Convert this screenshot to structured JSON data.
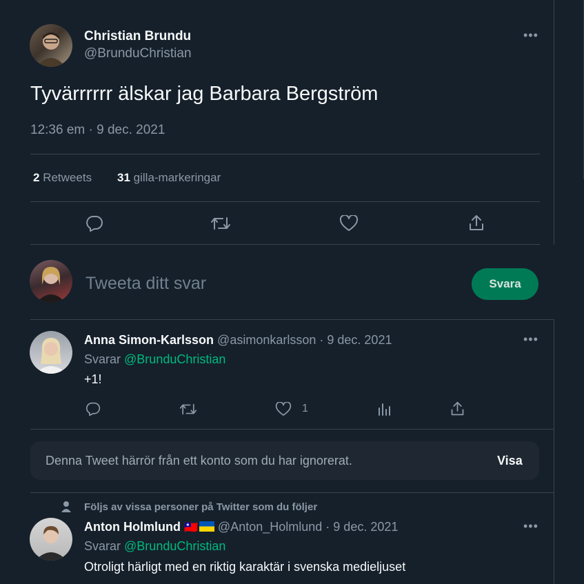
{
  "main_tweet": {
    "author_name": "Christian Brundu",
    "author_handle": "@BrunduChristian",
    "text": "Tyvärrrrrr älskar jag Barbara Bergström",
    "timestamp": "12:36 em · 9 dec. 2021",
    "retweets_count": "2",
    "retweets_label": "Retweets",
    "likes_count": "31",
    "likes_label": "gilla-markeringar"
  },
  "reply_composer": {
    "placeholder": "Tweeta ditt svar",
    "button_label": "Svara"
  },
  "replies": [
    {
      "author_name": "Anna Simon-Karlsson",
      "author_handle": "@asimonkarlsson",
      "date": "· 9 dec. 2021",
      "replying_prefix": "Svarar",
      "replying_to": "@BrunduChristian",
      "text": "+1!",
      "like_count": "1"
    },
    {
      "social_context": "Följs av vissa personer på Twitter som du följer",
      "author_name": "Anton Holmlund",
      "author_flags": "🇹🇼",
      "author_handle": "@Anton_Holmlund",
      "date": "· 9 dec. 2021",
      "replying_prefix": "Svarar",
      "replying_to": "@BrunduChristian",
      "text": "Otroligt härligt med en riktig karaktär i svenska medieljuset"
    }
  ],
  "ignored_notice": {
    "text": "Denna Tweet härrör från ett konto som du har ignorerat.",
    "button_label": "Visa"
  },
  "colors": {
    "background": "#15202b",
    "accent_green": "#00ba7c",
    "button_green": "#007a55",
    "muted": "#8b98a5",
    "border": "#38444d"
  },
  "icons": [
    "more-icon",
    "reply-icon",
    "retweet-icon",
    "like-icon",
    "share-icon",
    "analytics-icon",
    "person-icon",
    "ukraine-flag-icon"
  ]
}
